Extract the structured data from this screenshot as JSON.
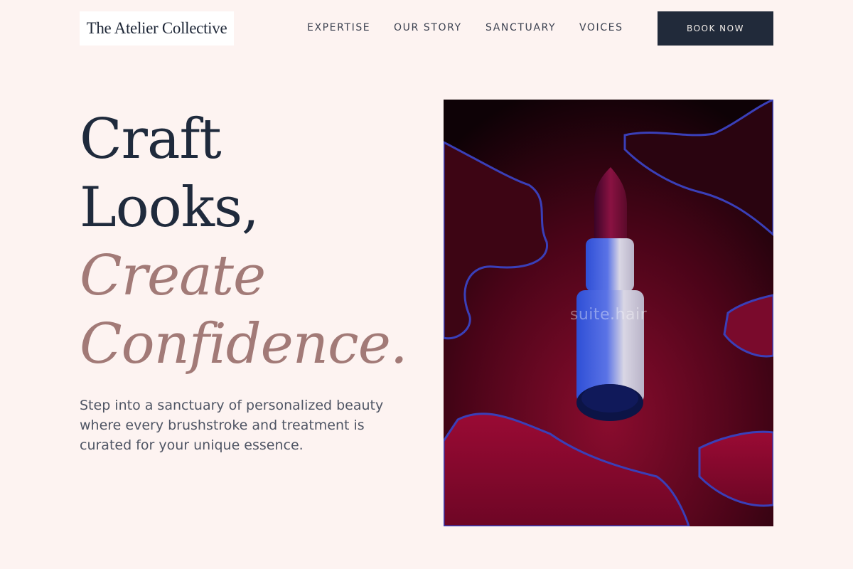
{
  "header": {
    "logo_text": "The Atelier Collective",
    "nav": [
      {
        "label": "EXPERTISE"
      },
      {
        "label": "OUR STORY"
      },
      {
        "label": "SANCTUARY"
      },
      {
        "label": "VOICES"
      }
    ],
    "cta_label": "BOOK NOW"
  },
  "hero": {
    "title_lines": [
      "Craft",
      "Looks,"
    ],
    "accent_lines": [
      "Create",
      "Confidence."
    ],
    "tagline": "Step into a sanctuary of personalized beauty where every brushstroke and treatment is curated for your unique essence.",
    "image": {
      "subject": "lipstick-on-red-liquid",
      "watermark": "suite.hair"
    }
  },
  "colors": {
    "background": "#fdf3f1",
    "navy": "#1f2a3c",
    "accent_rose": "#a27a77",
    "button_bg": "#212a3a",
    "body_text": "#4f5564"
  }
}
